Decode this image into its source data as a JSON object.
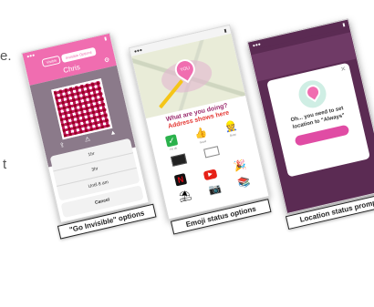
{
  "edge_text": [
    "e.",
    "t"
  ],
  "panels": {
    "invisible": {
      "header_tabs": [
        "Visible",
        "Invisible Options"
      ],
      "profile_name": "Chris",
      "sheet_options": [
        "1hr",
        "3hr",
        "Until 8 am"
      ],
      "cancel_label": "Cancel",
      "caption": "\"Go Invisible\" options"
    },
    "emoji": {
      "pin_label": "YOU",
      "prompt": "What are you doing?",
      "address_note": "Address shows here",
      "row1_labels": [
        "I'm ok",
        "Good",
        "Busy"
      ],
      "caption": "Emoji status options"
    },
    "location": {
      "modal_text": "Oh... you need to set location to \"Always\"",
      "caption": "Location status prompt"
    }
  },
  "colors": {
    "brand_pink": "#f06db0",
    "plum_background": "#5b2b53",
    "prompt_purple": "#9b2d6f",
    "note_red": "#e53935"
  }
}
